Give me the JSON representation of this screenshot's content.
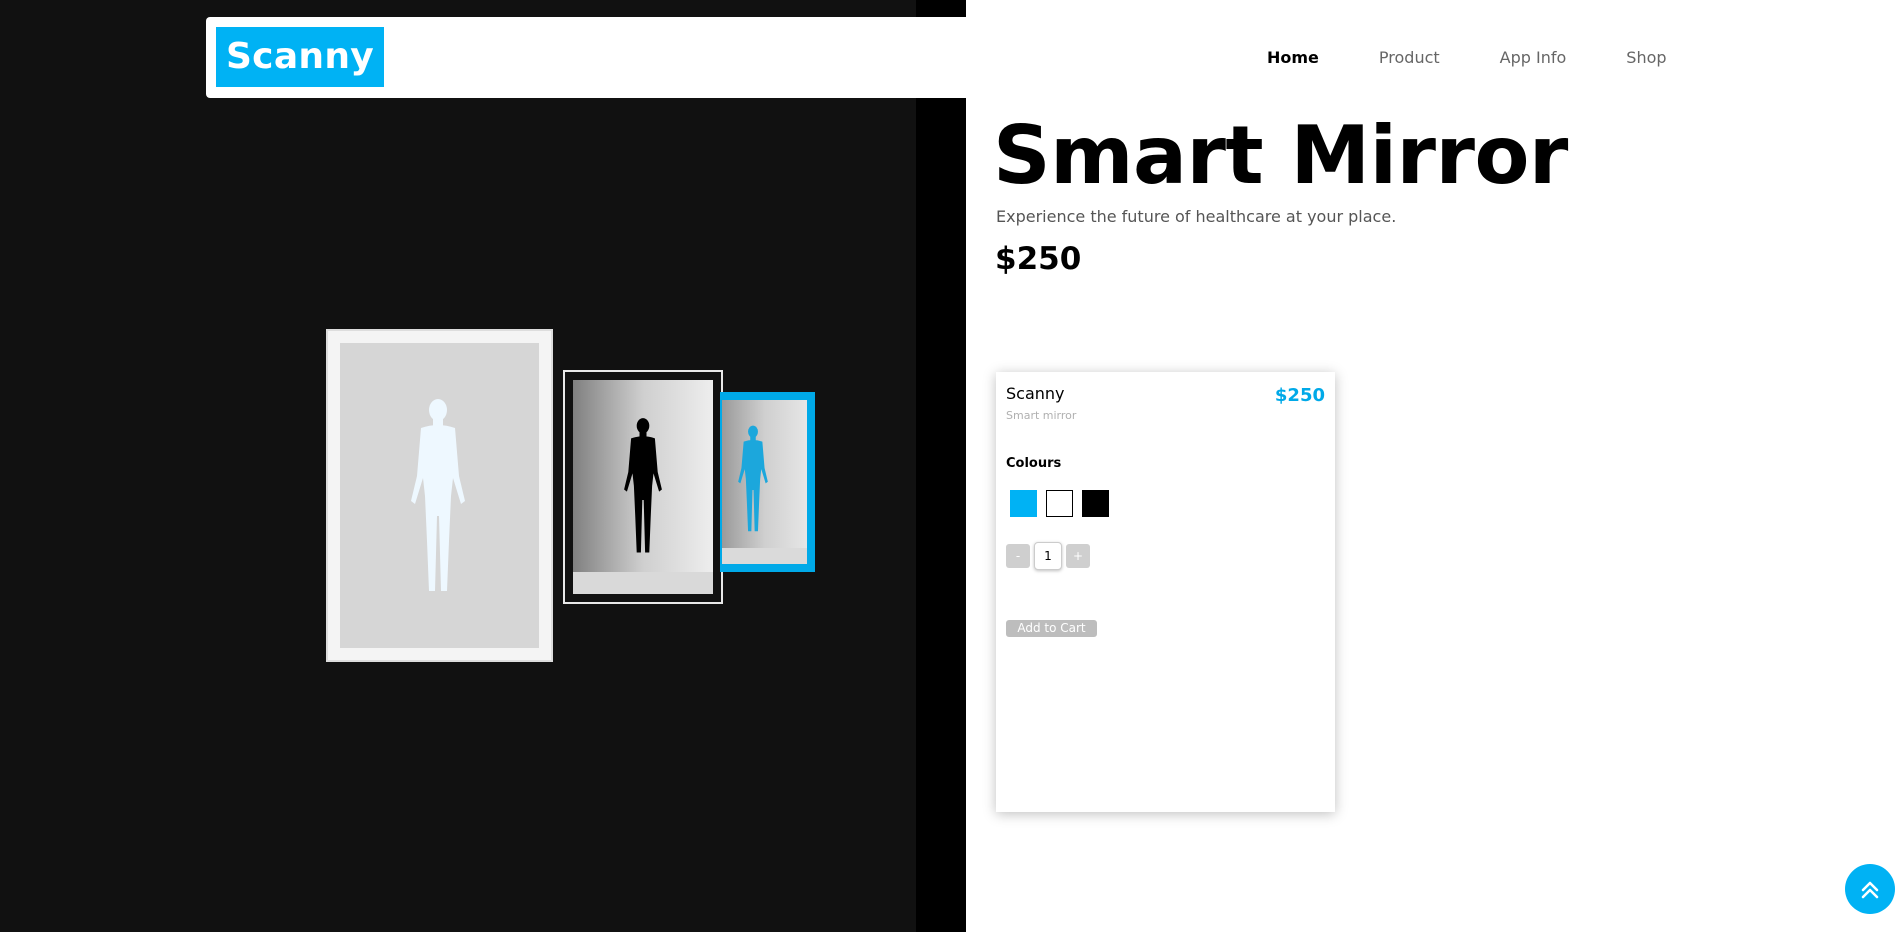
{
  "header": {
    "logo": "Scanny",
    "nav": [
      "Home",
      "Product",
      "App Info",
      "Shop"
    ],
    "active_nav": "Home"
  },
  "hero": {
    "title": "Smart Mirror",
    "subtitle": "Experience the future of healthcare at your place.",
    "price": "$250"
  },
  "card": {
    "name": "Scanny",
    "subtitle": "Smart mirror",
    "price": "$250",
    "colours_label": "Colours",
    "colours": [
      "#00b2f4",
      "#ffffff",
      "#000000"
    ],
    "quantity": "1",
    "minus_label": "-",
    "plus_label": "+",
    "add_to_cart": "Add to Cart"
  },
  "icons": {
    "scroll_top": "double-chevron-up-icon",
    "figures": [
      "human-figure-icon",
      "human-figure-icon",
      "human-figure-icon"
    ]
  },
  "colors": {
    "accent": "#00b2f4",
    "dark_bg": "#111111"
  }
}
